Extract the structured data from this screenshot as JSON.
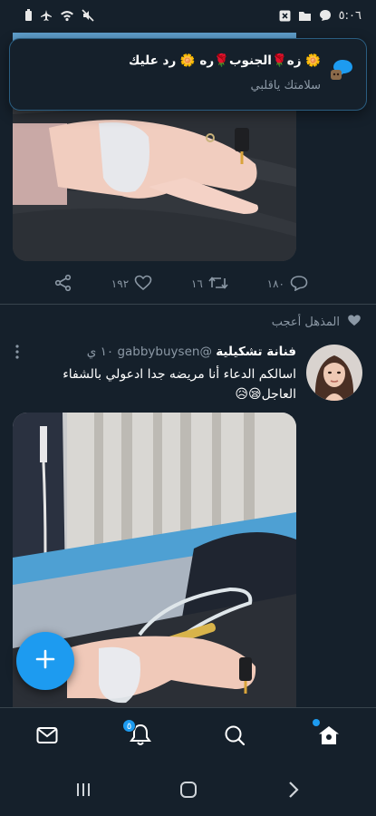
{
  "status_bar": {
    "time": "٥:٠٦",
    "left_icons": [
      "battery-icon",
      "airplane-icon",
      "wifi-icon",
      "mute-icon"
    ],
    "right_icons": [
      "notification-x-icon",
      "folder-icon",
      "message-icon"
    ]
  },
  "notification_banner": {
    "title": "🌼 زه🌹الجنوب🌹ره 🌼 رد عليك",
    "text": "سلامتك ياقلبي",
    "icon": "reply-bubble-icon"
  },
  "top_tweet_actions": {
    "share_icon": "share-icon",
    "likes": "١٩٢",
    "retweets": "١٦",
    "replies": "١٨٠"
  },
  "liked_by_header": "المذهل أعجب",
  "tweet": {
    "author_name": "فنانة تشكيلية",
    "handle": "@gabbybuysen",
    "time": "١٠ ي",
    "text": "اسالكم الدعاء أنا  مريضه جدا ادعولي بالشفاء العاجل😪😥"
  },
  "fab_label": "+",
  "bottom_nav": {
    "items": [
      "mail-icon",
      "notifications-icon",
      "search-icon",
      "home-icon"
    ],
    "notifications_badge": "٥"
  },
  "android_nav": [
    "recent-apps-icon",
    "home-button-icon",
    "back-icon"
  ],
  "colors": {
    "background": "#15202b",
    "accent": "#1d9bf0",
    "muted_text": "#8b98a5",
    "divider": "#38444d"
  }
}
